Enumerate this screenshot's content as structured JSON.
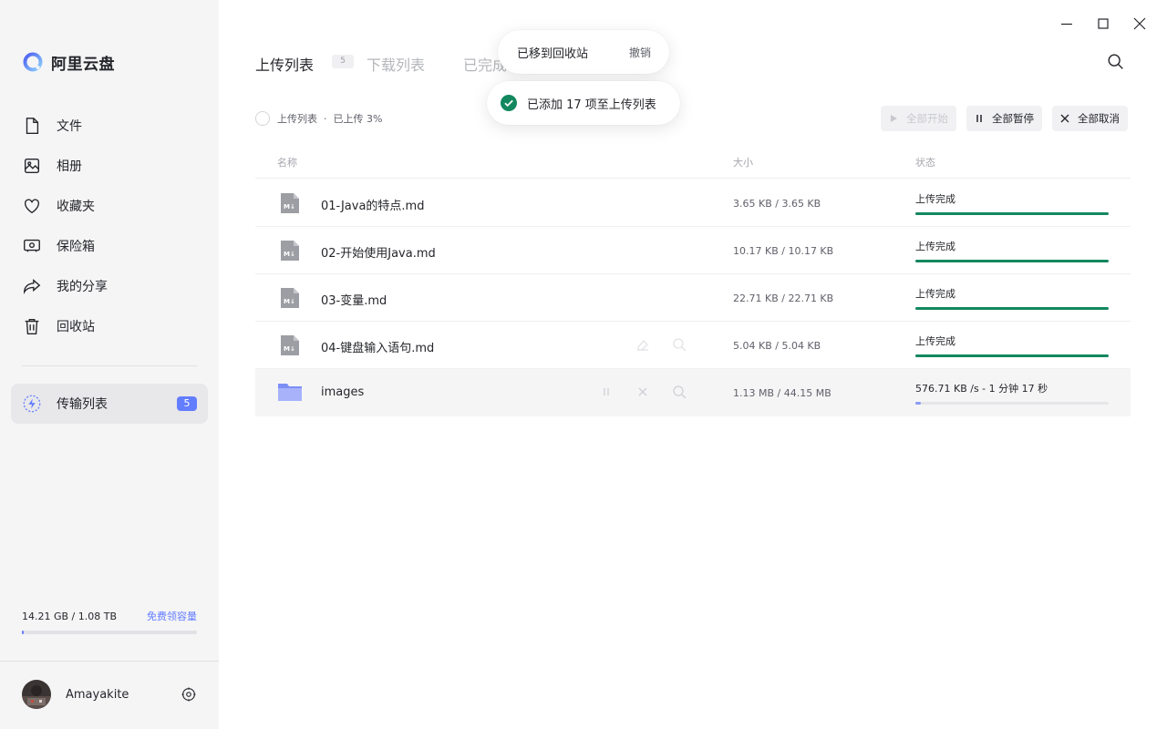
{
  "brand": {
    "name": "阿里云盘"
  },
  "sidebar": {
    "items": [
      {
        "label": "文件",
        "icon": "file-icon"
      },
      {
        "label": "相册",
        "icon": "photo-album-icon"
      },
      {
        "label": "收藏夹",
        "icon": "heart-icon"
      },
      {
        "label": "保险箱",
        "icon": "safe-icon"
      },
      {
        "label": "我的分享",
        "icon": "share-icon"
      },
      {
        "label": "回收站",
        "icon": "trash-icon"
      }
    ],
    "transfer": {
      "label": "传输列表",
      "badge": "5",
      "icon": "lightning-icon"
    }
  },
  "storage": {
    "used_text": "14.21 GB / 1.08 TB",
    "link": "免费领容量",
    "used_fraction": 0.013
  },
  "user": {
    "name": "Amayakite"
  },
  "tabs": [
    {
      "label": "上传列表",
      "count": "5",
      "active": true
    },
    {
      "label": "下载列表",
      "active": false
    },
    {
      "label": "已完成",
      "active": false
    }
  ],
  "summary": {
    "label": "上传列表",
    "separator": "·",
    "progress": "已上传 3%"
  },
  "toolbar": {
    "start_all": "全部开始",
    "pause_all": "全部暂停",
    "cancel_all": "全部取消"
  },
  "table": {
    "headers": {
      "name": "名称",
      "size": "大小",
      "status": "状态"
    },
    "rows": [
      {
        "name": "01-Java的特点.md",
        "size": "3.65 KB / 3.65 KB",
        "status": "上传完成",
        "progress": 1.0,
        "type": "markdown-file"
      },
      {
        "name": "02-开始使用Java.md",
        "size": "10.17 KB / 10.17 KB",
        "status": "上传完成",
        "progress": 1.0,
        "type": "markdown-file"
      },
      {
        "name": "03-变量.md",
        "size": "22.71 KB / 22.71 KB",
        "status": "上传完成",
        "progress": 1.0,
        "type": "markdown-file"
      },
      {
        "name": "04-键盘输入语句.md",
        "size": "5.04 KB / 5.04 KB",
        "status": "上传完成",
        "progress": 1.0,
        "type": "markdown-file"
      },
      {
        "name": "images",
        "size": "1.13 MB / 44.15 MB",
        "status": "576.71 KB /s - 1 分钟 17 秒",
        "progress": 0.026,
        "type": "folder"
      }
    ]
  },
  "toasts": {
    "moved": {
      "text": "已移到回收站",
      "action": "撤销"
    },
    "added": {
      "text": "已添加 17 项至上传列表"
    }
  },
  "colors": {
    "accent": "#637dff",
    "success": "#13885f",
    "sidebar_bg": "#f5f5f6"
  }
}
